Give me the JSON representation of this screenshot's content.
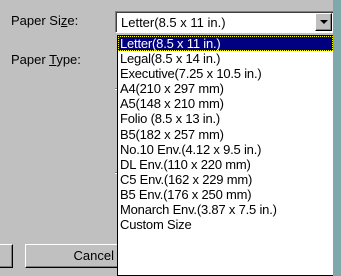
{
  "labels": {
    "paper_size": "Paper Size:",
    "paper_size_prefix": "Paper Si",
    "paper_size_accel": "z",
    "paper_size_suffix": "e:",
    "paper_type_prefix": "Paper ",
    "paper_type_accel": "T",
    "paper_type_suffix": "ype:"
  },
  "combo": {
    "value": "Letter(8.5 x 11 in.)",
    "open_icon": "chevron-down-icon"
  },
  "dropdown": {
    "selected_index": 0,
    "options": [
      "Letter(8.5 x 11 in.)",
      "Legal(8.5 x 14 in.)",
      "Executive(7.25 x 10.5 in.)",
      "A4(210 x 297 mm)",
      "A5(148 x 210 mm)",
      "Folio (8.5 x 13 in.)",
      "B5(182 x 257 mm)",
      "No.10 Env.(4.12 x 9.5 in.)",
      "DL Env.(110 x 220 mm)",
      "C5 Env.(162 x 229 mm)",
      "B5 Env.(176 x 250 mm)",
      "Monarch Env.(3.87 x 7.5 in.)",
      "Custom Size"
    ]
  },
  "buttons": {
    "cancel": "Cancel"
  },
  "colors": {
    "face": "#c0c0c0",
    "highlight": "#000080",
    "desktop": "#7ea8ac"
  }
}
